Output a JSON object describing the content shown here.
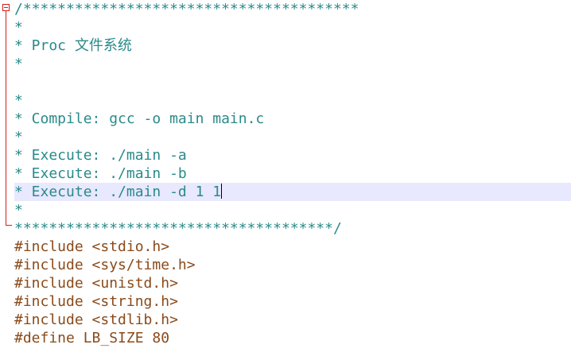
{
  "editor": {
    "lines": [
      "/***************************************",
      "*",
      "* Proc 文件系统",
      "*",
      "",
      "*",
      "* Compile: gcc -o main main.c",
      "*",
      "* Execute: ./main -a",
      "* Execute: ./main -b",
      "* Execute: ./main -d 1 1",
      "*",
      "*************************************/",
      "#include <stdio.h>",
      "#include <sys/time.h>",
      "#include <unistd.h>",
      "#include <string.h>",
      "#include <stdlib.h>",
      "#define LB_SIZE 80"
    ],
    "current_line_index": 10,
    "colors": {
      "comment": "#2a8a8a",
      "preprocessor": "#8a4a1a",
      "current_line_highlight": "#e8e8ff",
      "fold_marker": "#d81b1b"
    }
  }
}
